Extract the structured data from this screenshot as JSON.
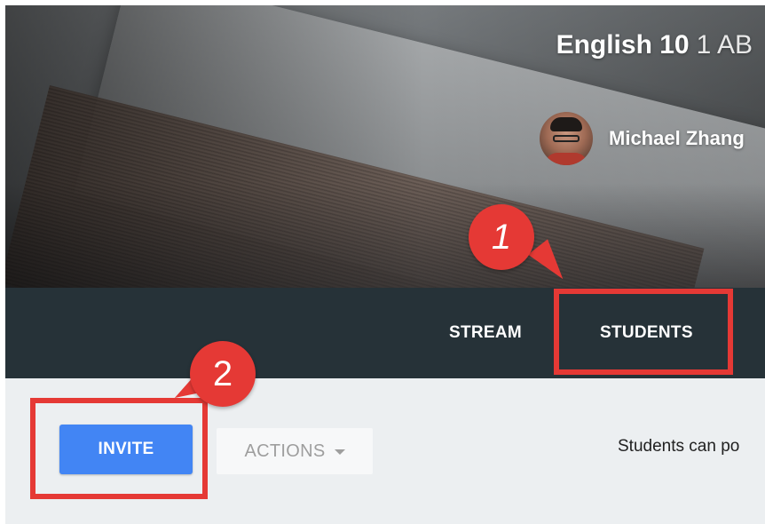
{
  "header": {
    "class_name": "English 10",
    "section": "1 AB",
    "teacher_name": "Michael Zhang"
  },
  "nav": {
    "tabs": [
      {
        "label": "STREAM"
      },
      {
        "label": "STUDENTS"
      }
    ]
  },
  "toolbar": {
    "invite_label": "INVITE",
    "actions_label": "ACTIONS",
    "students_note": "Students can po"
  },
  "annotations": {
    "badge_1": "1",
    "badge_2": "2",
    "color": "#e53935"
  },
  "colors": {
    "nav_bg": "#263238",
    "invite_bg": "#4285f4",
    "content_bg": "#eceff1"
  },
  "icons": {
    "actions_caret": "chevron-down-icon"
  }
}
